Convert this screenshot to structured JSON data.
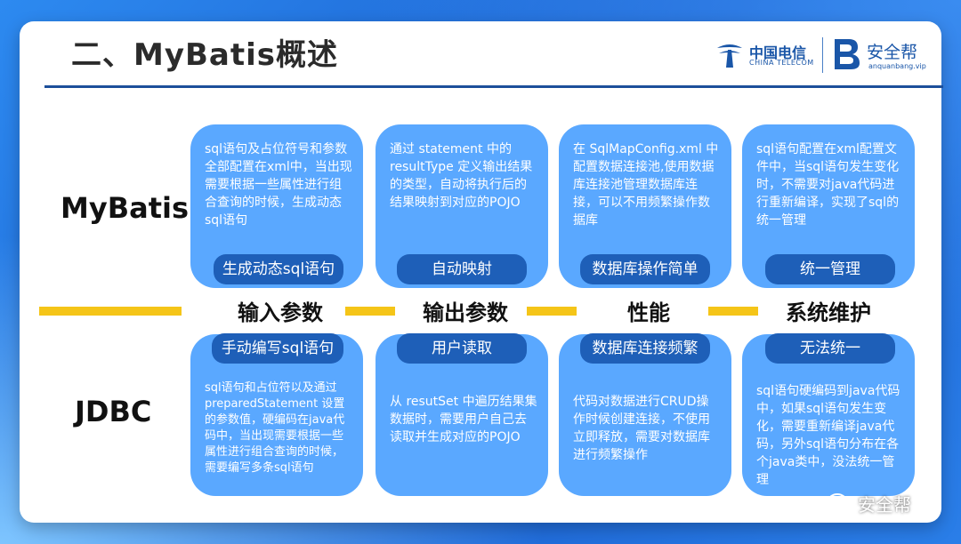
{
  "slide": {
    "title": "二、MyBatis概述",
    "logos": {
      "telecom_cn": "中国电信",
      "telecom_en": "CHINA TELECOM",
      "aqb_name": "安全帮",
      "aqb_url": "anquanbang.vip"
    },
    "rows": {
      "mybatis": "MyBatis",
      "jdbc": "JDBC"
    },
    "columns": [
      {
        "label": "输入参数",
        "mybatis_desc": "sql语句及占位符号和参数全部配置在xml中，当出现需要根据一些属性进行组合查询的时候，生成动态sql语句",
        "mybatis_tag": "生成动态sql语句",
        "jdbc_tag": "手动编写sql语句",
        "jdbc_desc": "sql语句和占位符以及通过 preparedStatement 设置的参数值，硬编码在java代码中，当出现需要根据一些属性进行组合查询的时候，需要编写多条sql语句"
      },
      {
        "label": "输出参数",
        "mybatis_desc": "通过 statement 中的 resultType 定义输出结果的类型，自动将执行后的结果映射到对应的POJO",
        "mybatis_tag": "自动映射",
        "jdbc_tag": "用户读取",
        "jdbc_desc": "从 resutSet 中遍历结果集数据时，需要用户自己去读取并生成对应的POJO"
      },
      {
        "label": "性能",
        "mybatis_desc": "在 SqlMapConfig.xml 中配置数据连接池,使用数据库连接池管理数据库连接，可以不用频繁操作数据库",
        "mybatis_tag": "数据库操作简单",
        "jdbc_tag": "数据库连接频繁",
        "jdbc_desc": "代码对数据进行CRUD操作时候创建连接，不使用立即释放，需要对数据库进行频繁操作"
      },
      {
        "label": "系统维护",
        "mybatis_desc": "sql语句配置在xml配置文件中，当sql语句发生变化时，不需要对java代码进行重新编译，实现了sql的统一管理",
        "mybatis_tag": "统一管理",
        "jdbc_tag": "无法统一",
        "jdbc_desc": "sql语句硬编码到java代码中，如果sql语句发生变化，需要重新编译java代码，另外sql语句分布在各个java类中，没法统一管理"
      }
    ],
    "watermark": "安全帮",
    "colors": {
      "card": "#5aa8ff",
      "tag": "#1e5fb8",
      "divider": "#f5c518",
      "background": "#1f6fd8"
    }
  }
}
